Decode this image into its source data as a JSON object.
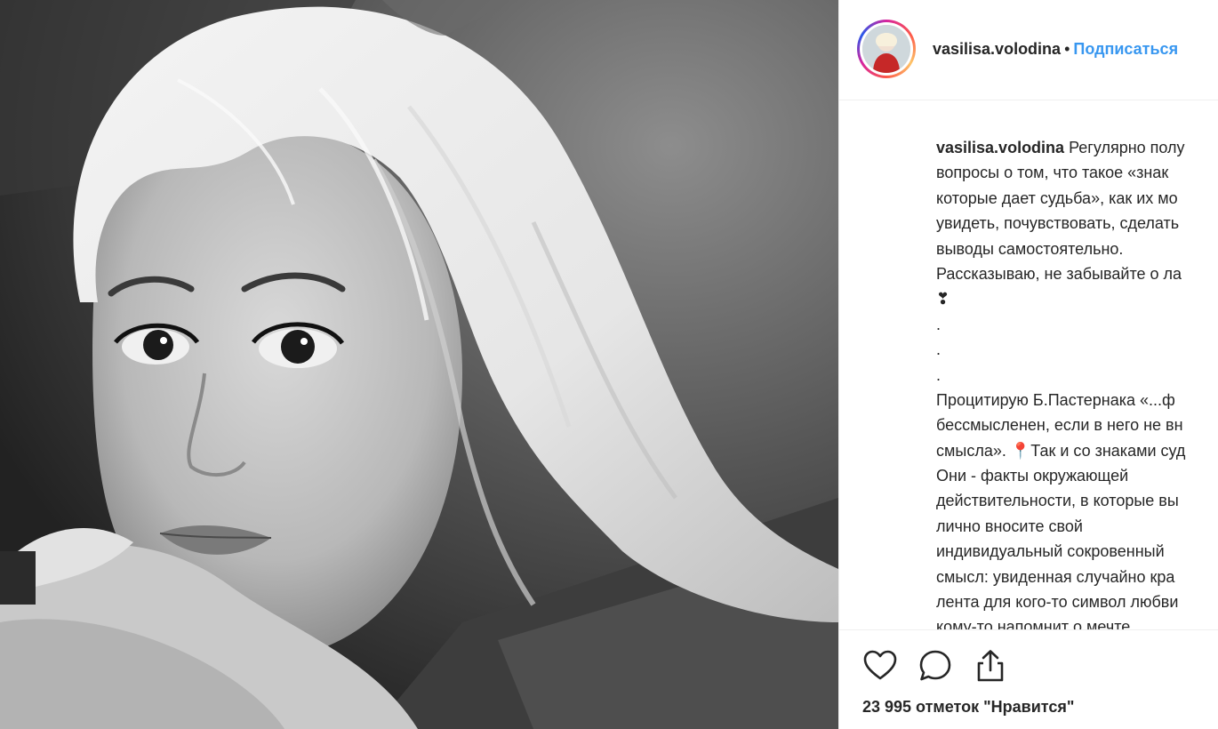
{
  "post": {
    "author": {
      "username": "vasilisa.volodina",
      "separator": "•",
      "follow_label": "Подписаться",
      "avatar_icon": "avatar-photo"
    },
    "caption": {
      "username": "vasilisa.volodina",
      "first_line_text": " Регулярно полу",
      "lines": [
        "вопросы о том, что такое «знак",
        "которые дает судьба», как их мо",
        "увидеть, почувствовать, сделать",
        "выводы самостоятельно.",
        "Рассказываю, не забывайте о ла",
        "❣",
        ".",
        ".",
        ".",
        "Процитирую Б.Пастернака «...ф",
        "бессмысленен, если в него не вн",
        "смысла». 📍Так и со знаками суд",
        "Они - факты окружающей",
        "действительности, в которые вы",
        "лично вносите свой",
        "индивидуальный сокровенный",
        "смысл: увиденная случайно кра",
        "лента для кого-то символ любви",
        "кому-то напомнит о мечте"
      ]
    },
    "actions": {
      "like_icon": "heart-icon",
      "comment_icon": "comment-icon",
      "share_icon": "share-icon"
    },
    "likes_text": "23 995 отметок \"Нравится\"",
    "colors": {
      "accent": "#3897f0",
      "text": "#262626",
      "divider": "#efefef"
    }
  }
}
